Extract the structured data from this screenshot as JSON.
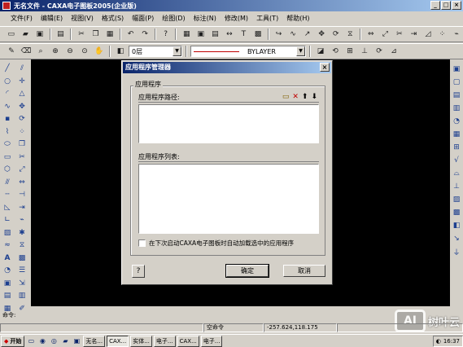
{
  "window": {
    "title": "无名文件 - CAXA电子图板2005(企业版)"
  },
  "menu": [
    "文件(F)",
    "编辑(E)",
    "视图(V)",
    "格式(S)",
    "幅面(P)",
    "绘图(D)",
    "标注(N)",
    "修改(M)",
    "工具(T)",
    "帮助(H)"
  ],
  "toolbar2": {
    "layer": "0层",
    "linetype": "BYLAYER"
  },
  "dialog": {
    "title": "应用程序管理器",
    "group_label": "应用程序",
    "path_header": "应用程序路径:",
    "list_header": "应用程序列表:",
    "checkbox_label": "在下次启动CAXA电子图板时自动加载选中的应用程序",
    "ok": "确定",
    "cancel": "取消",
    "help": "?"
  },
  "cmdline": {
    "label": "命令:"
  },
  "status": {
    "cmd": "空命令",
    "coords": "-257.624,118.175"
  },
  "taskbar": {
    "start": "开始",
    "buttons": [
      "无名...",
      "CAX...",
      "实体...",
      "电子...",
      "CAX...",
      "电子..."
    ],
    "clock": "16:37"
  },
  "watermark": {
    "logo": "AI",
    "text": "树叶云"
  }
}
